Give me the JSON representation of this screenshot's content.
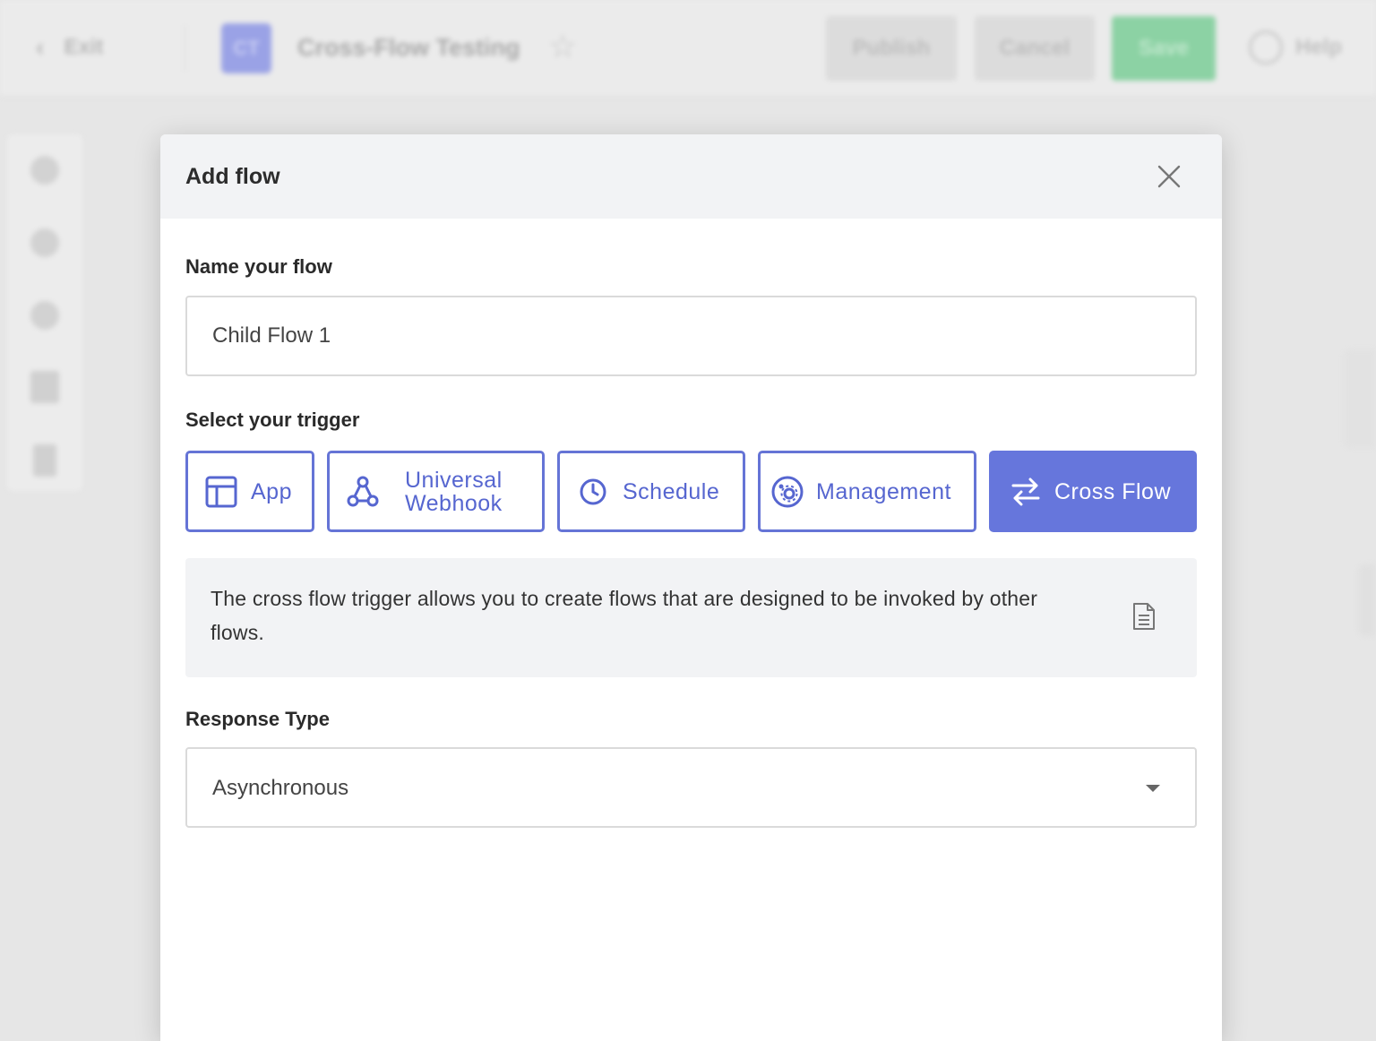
{
  "background": {
    "exit_label": "Exit",
    "app_badge": "CT",
    "flow_title": "Cross-Flow Testing",
    "publish_label": "Publish",
    "cancel_label": "Cancel",
    "save_label": "Save",
    "help_label": "Help"
  },
  "modal": {
    "title": "Add flow",
    "name_label": "Name your flow",
    "name_value": "Child Flow 1",
    "trigger_label": "Select your trigger",
    "triggers": [
      {
        "label": "App",
        "icon": "app-layout-icon",
        "active": false
      },
      {
        "label": "Universal Webhook",
        "icon": "webhook-icon",
        "active": false
      },
      {
        "label": "Schedule",
        "icon": "clock-icon",
        "active": false
      },
      {
        "label": "Management",
        "icon": "management-gear-icon",
        "active": false
      },
      {
        "label": "Cross Flow",
        "icon": "swap-arrows-icon",
        "active": true
      }
    ],
    "info_text": "The cross flow trigger allows you to create flows that are designed to be invoked by other flows.",
    "response_label": "Response Type",
    "response_value": "Asynchronous"
  },
  "colors": {
    "accent": "#6676dc",
    "accent_text": "#5666d0",
    "header_bg": "#f2f3f5"
  }
}
